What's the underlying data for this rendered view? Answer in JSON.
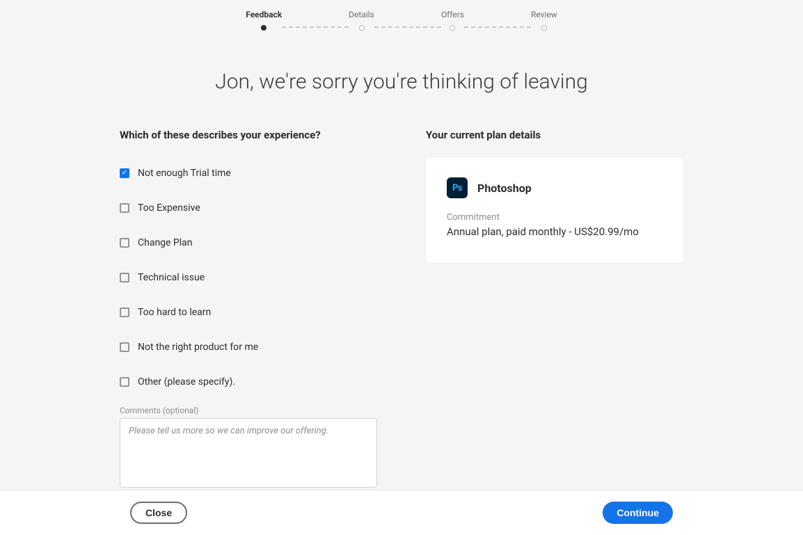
{
  "stepper": {
    "steps": [
      {
        "label": "Feedback",
        "active": true
      },
      {
        "label": "Details",
        "active": false
      },
      {
        "label": "Offers",
        "active": false
      },
      {
        "label": "Review",
        "active": false
      }
    ]
  },
  "page_title": "Jon, we're sorry you're thinking of leaving",
  "question": "Which of these describes your experience?",
  "options": [
    {
      "label": "Not enough Trial time",
      "checked": true
    },
    {
      "label": "Too Expensive",
      "checked": false
    },
    {
      "label": "Change Plan",
      "checked": false
    },
    {
      "label": "Technical issue",
      "checked": false
    },
    {
      "label": "Too hard to learn",
      "checked": false
    },
    {
      "label": "Not the right product for me",
      "checked": false
    },
    {
      "label": "Other (please specify).",
      "checked": false
    }
  ],
  "comments": {
    "label": "Comments (optional)",
    "placeholder": "Please tell us more so we can improve our offering."
  },
  "plan": {
    "heading": "Your current plan details",
    "product_icon_text": "Ps",
    "product_name": "Photoshop",
    "commitment_label": "Commitment",
    "commitment_value": "Annual plan, paid monthly - US$20.99/mo"
  },
  "buttons": {
    "close": "Close",
    "continue": "Continue"
  }
}
